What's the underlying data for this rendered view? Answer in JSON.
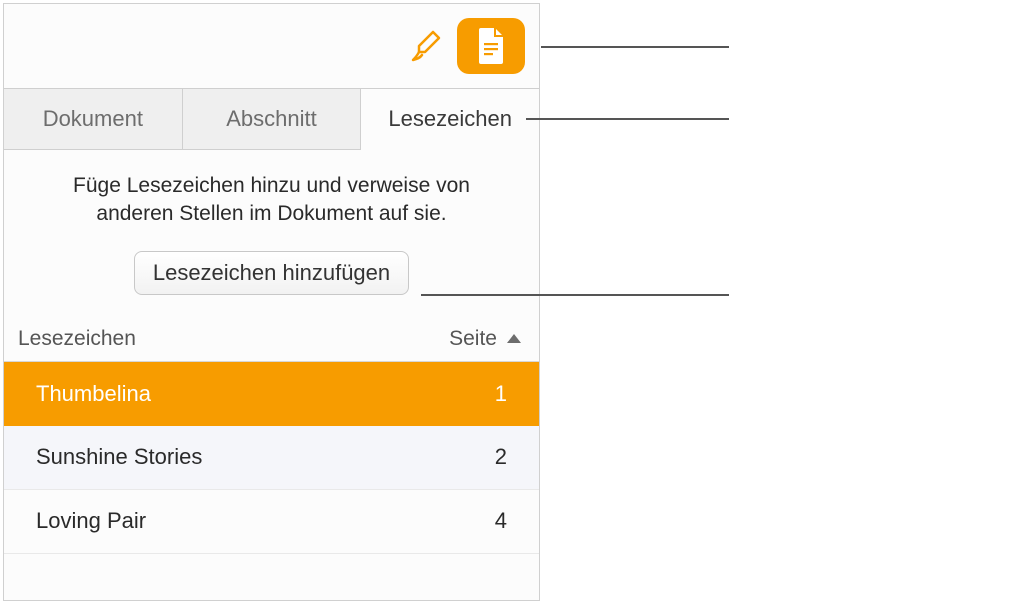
{
  "toolbar": {
    "brush_icon": "brush-icon",
    "doc_icon": "document-icon"
  },
  "tabs": {
    "document": "Dokument",
    "section": "Abschnitt",
    "bookmarks": "Lesezeichen"
  },
  "info": {
    "text": "Füge Lesezeichen hinzu und verweise von anderen Stellen im Dokument auf sie.",
    "add_button": "Lesezeichen hinzufügen"
  },
  "list_header": {
    "name": "Lesezeichen",
    "page": "Seite"
  },
  "bookmarks": [
    {
      "name": "Thumbelina",
      "page": "1"
    },
    {
      "name": "Sunshine Stories",
      "page": "2"
    },
    {
      "name": "Loving Pair",
      "page": "4"
    }
  ]
}
